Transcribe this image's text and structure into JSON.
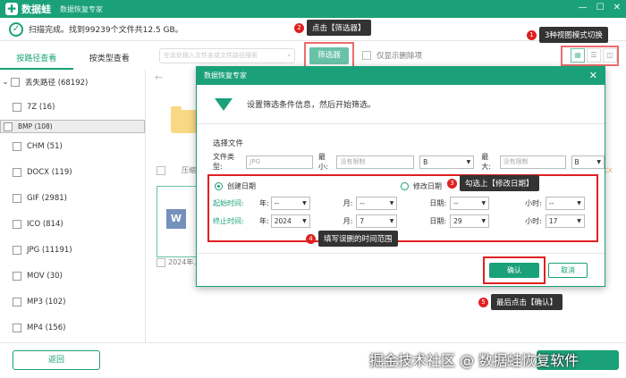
{
  "app": {
    "name": "数据蛙",
    "subtitle": "数据恢复专家"
  },
  "window_controls": [
    "—",
    "☐",
    "✕"
  ],
  "status": {
    "text": "扫描完成。找到99239个文件共12.5 GB。"
  },
  "tabs": [
    {
      "label": "按路径查看",
      "active": true
    },
    {
      "label": "按类型查看",
      "active": false
    }
  ],
  "sidebar": {
    "root": "丢失路径 (68192)",
    "items": [
      {
        "label": "7Z (16)"
      },
      {
        "label": "BMP (108)",
        "selected": true
      },
      {
        "label": "CHM (51)"
      },
      {
        "label": "DOCX (119)"
      },
      {
        "label": "GIF (2981)"
      },
      {
        "label": "ICO (814)"
      },
      {
        "label": "JPG (11191)"
      },
      {
        "label": "MOV (30)"
      },
      {
        "label": "MP3 (102)"
      },
      {
        "label": "MP4 (156)"
      }
    ]
  },
  "toolbar": {
    "search_placeholder": "在此处输入文件名或文件路径搜索",
    "filter_label": "筛选器",
    "only_deleted_label": "仅显示删除项"
  },
  "content": {
    "compress_label": "压缩",
    "file_label": "2024年...",
    "cx_fragment": "CX"
  },
  "modal": {
    "title": "数据恢复专家",
    "close": "✕",
    "header_text": "设置筛选条件信息，然后开始筛选。",
    "select_file_label": "选择文件",
    "file_type_label": "文件类型:",
    "file_type_placeholder": "JPG",
    "min_label": "最小:",
    "min_placeholder": "没有限制",
    "min_unit": "B",
    "max_label": "最大:",
    "max_placeholder": "没有限制",
    "max_unit": "B",
    "created_date_label": "创建日期",
    "modified_date_label": "修改日期",
    "start_time_label": "起始时间:",
    "end_time_label": "终止时间:",
    "year_label": "年:",
    "month_label": "月:",
    "day_label": "日期:",
    "hour_label": "小时:",
    "start": {
      "year": "--",
      "month": "--",
      "day": "--",
      "hour": "--"
    },
    "end": {
      "year": "2024",
      "month": "7",
      "day": "29",
      "hour": "17"
    },
    "confirm_label": "确认",
    "cancel_label": "取消"
  },
  "callouts": [
    {
      "num": "1",
      "text": "3种视图模式切换"
    },
    {
      "num": "2",
      "text": "点击【筛选器】"
    },
    {
      "num": "3",
      "text": "勾选上【修改日期】"
    },
    {
      "num": "4",
      "text": "填写误删的时间范围"
    },
    {
      "num": "5",
      "text": "最后点击【确认】"
    }
  ],
  "bottom": {
    "back_label": "返回",
    "watermark": "掘金技术社区 @ 数据蛙恢复软件"
  },
  "colors": {
    "accent": "#1aa179",
    "annotation": "#e02020"
  }
}
